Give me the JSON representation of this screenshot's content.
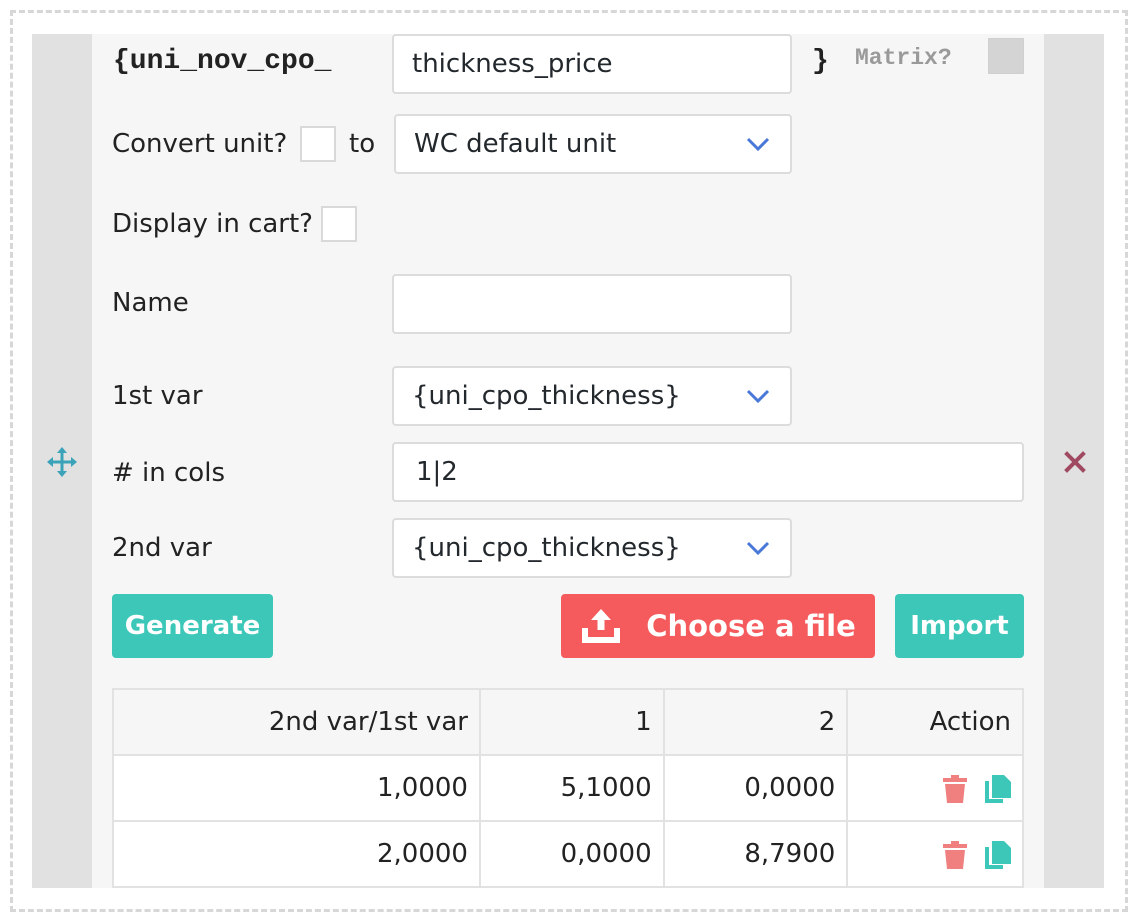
{
  "header": {
    "var_prefix": "{uni_nov_cpo_",
    "var_name_value": "thickness_price",
    "closing_brace": "}",
    "matrix_label": "Matrix?"
  },
  "convert": {
    "label": "Convert unit?",
    "to_label": "to",
    "unit_selected": "WC default unit"
  },
  "display_cart": {
    "label": "Display in cart?"
  },
  "name": {
    "label": "Name",
    "value": ""
  },
  "var1": {
    "label": "1st var",
    "selected": "{uni_cpo_thickness}"
  },
  "cols": {
    "label": "# in cols",
    "value": "1|2"
  },
  "var2": {
    "label": "2nd var",
    "selected": "{uni_cpo_thickness}"
  },
  "buttons": {
    "generate": "Generate",
    "choose_file": "Choose a file",
    "import": "Import"
  },
  "table": {
    "headers": [
      "2nd var/1st var",
      "1",
      "2",
      "Action"
    ],
    "rows": [
      [
        "1,0000",
        "5,1000",
        "0,0000"
      ],
      [
        "2,0000",
        "0,0000",
        "8,7900"
      ]
    ]
  },
  "colors": {
    "teal": "#3cc7b9",
    "red": "#f55a5c",
    "delete_icon": "#f08080",
    "copy_icon": "#3cc7b9",
    "move_icon": "#3aa3b8",
    "close_icon": "#a04a62",
    "chevron": "#4a78d8"
  },
  "icons": {
    "move": "move-arrows-icon",
    "close": "close-x-icon",
    "upload": "upload-icon",
    "delete": "trash-icon",
    "copy": "copy-icon",
    "dropdown": "chevron-down-icon"
  }
}
